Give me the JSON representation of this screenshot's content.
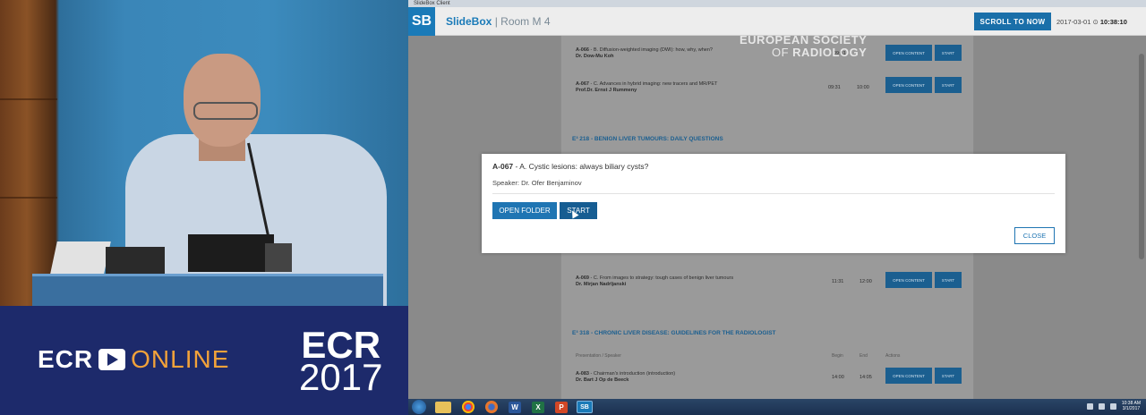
{
  "window": {
    "title": "SlideBox Client"
  },
  "header": {
    "badge": "SB",
    "app_name": "SlideBox",
    "room": "| Room M 4",
    "scroll_button": "SCROLL TO NOW",
    "date": "2017-03-01",
    "time": "10:38:10"
  },
  "watermark": {
    "line1": "EUROPEAN SOCIETY",
    "line2_prefix": "OF ",
    "line2_bold": "RADIOLOGY"
  },
  "sessions": {
    "items": [
      {
        "code": "A-066",
        "title": "B. Diffusion-weighted imaging (DWI): how, why, when?",
        "speaker": "Dr. Dow-Mu Koh",
        "start": "",
        "end": "09:31"
      },
      {
        "code": "A-067",
        "title": "C. Advances in hybrid imaging: new tracers and MR/PET",
        "speaker": "Prof.Dr. Ernst J Rummeny",
        "start": "09:31",
        "end": "10:00"
      },
      {
        "code": "A-069",
        "title": "C. From images to strategy: tough cases of benign liver tumours",
        "speaker": "Dr. Mirjan Nadrljanski",
        "start": "11:31",
        "end": "12:00"
      },
      {
        "code": "A-083",
        "title": "Chairman's introduction (introduction)",
        "speaker": "Dr. Bart J Op de Beeck",
        "start": "14:00",
        "end": "14:05"
      }
    ],
    "section1": "E³ 218 - BENIGN LIVER TUMOURS: DAILY QUESTIONS",
    "section2": "E³ 318 - CHRONIC LIVER DISEASE: GUIDELINES FOR THE RADIOLOGIST",
    "col_presentation": "Presentation / Speaker",
    "col_begin": "Begin",
    "col_end": "End",
    "col_actions": "Actions",
    "open_content": "OPEN CONTENT",
    "start": "START"
  },
  "modal": {
    "code": "A-067",
    "title": " - A. Cystic lesions: always biliary cysts?",
    "speaker": "Speaker: Dr. Ofer Benjaminov",
    "open_folder": "OPEN FOLDER",
    "start": "START",
    "close": "CLOSE"
  },
  "branding": {
    "ecr": "ECR",
    "online": "ONLINE",
    "year_top": "ECR",
    "year_bottom": "2017"
  },
  "taskbar": {
    "word": "W",
    "excel": "X",
    "ppt": "P",
    "sbapp": "SB",
    "clock_time": "10:38 AM",
    "clock_date": "3/1/2017"
  }
}
